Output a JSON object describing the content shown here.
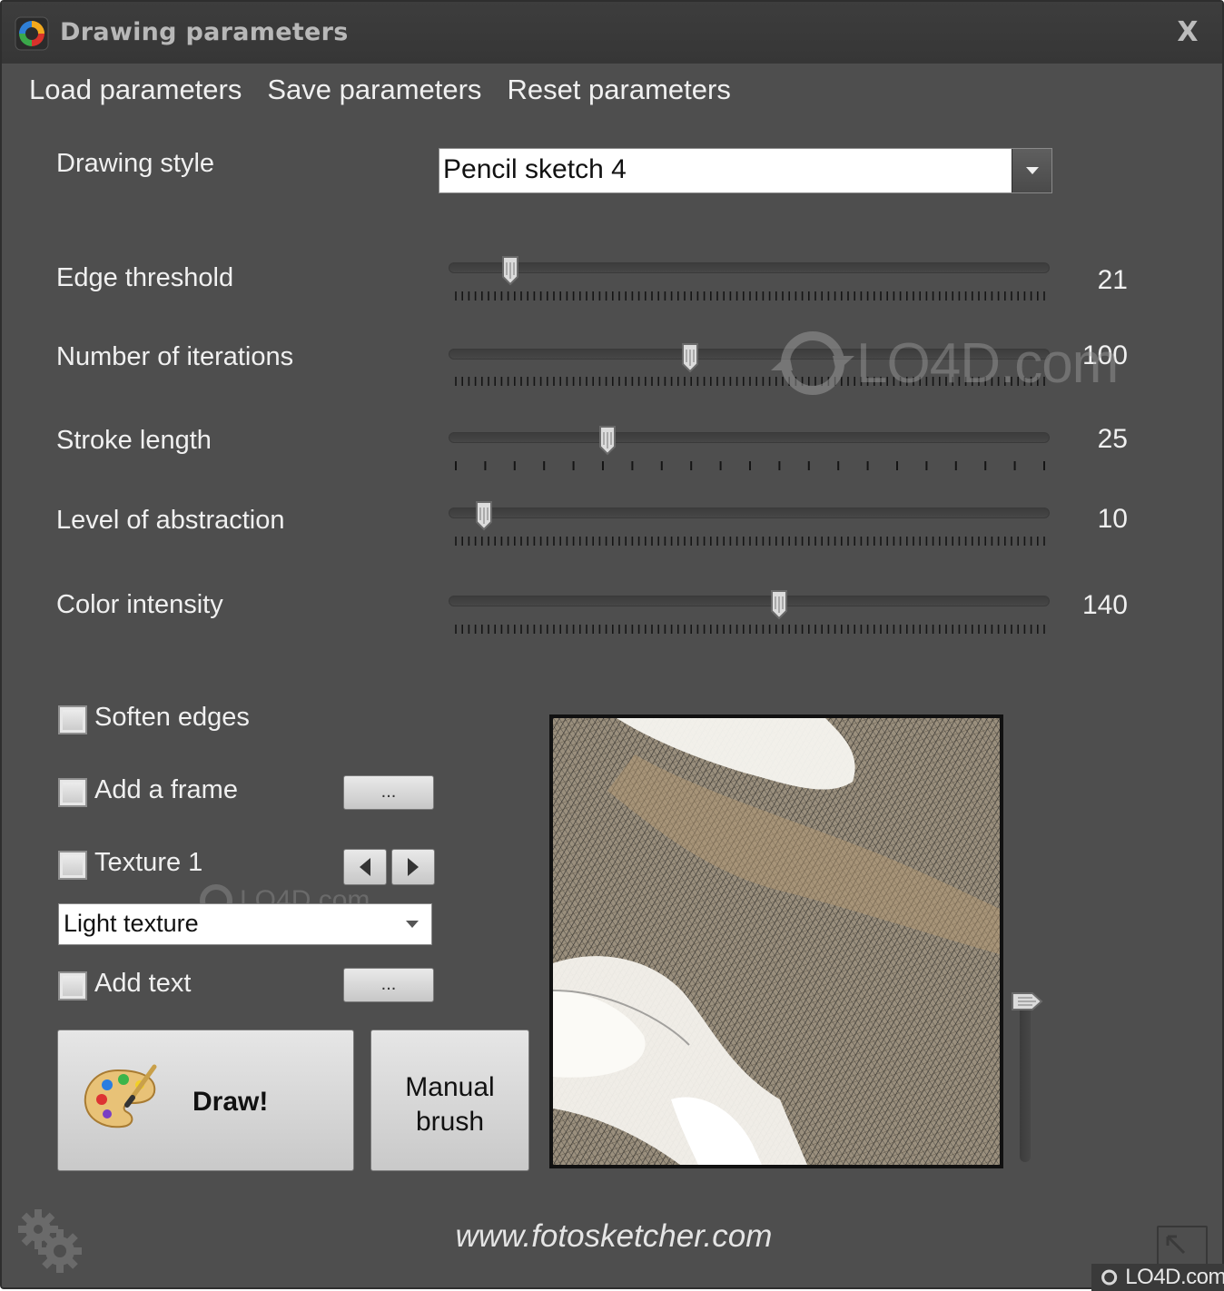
{
  "window": {
    "title": "Drawing parameters",
    "close_label": "X"
  },
  "menu": [
    "Load parameters",
    "Save parameters",
    "Reset parameters"
  ],
  "drawing_style": {
    "label": "Drawing style",
    "value": "Pencil sketch 4"
  },
  "sliders": [
    {
      "label": "Edge threshold",
      "value": "21",
      "position": 0.095,
      "ticks": "dense"
    },
    {
      "label": "Number of iterations",
      "value": "100",
      "position": 0.4,
      "ticks": "dense"
    },
    {
      "label": "Stroke length",
      "value": "25",
      "position": 0.26,
      "ticks": "sparse"
    },
    {
      "label": "Level of abstraction",
      "value": "10",
      "position": 0.05,
      "ticks": "dense"
    },
    {
      "label": "Color intensity",
      "value": "140",
      "position": 0.55,
      "ticks": "dense"
    }
  ],
  "options": {
    "soften_edges": {
      "label": "Soften edges",
      "checked": false
    },
    "add_frame": {
      "label": "Add a frame",
      "checked": false,
      "button": "..."
    },
    "texture": {
      "label": "Texture 1",
      "checked": false,
      "select_value": "Light texture"
    },
    "add_text": {
      "label": "Add text",
      "checked": false,
      "button": "..."
    }
  },
  "buttons": {
    "draw": "Draw!",
    "manual_line1": "Manual",
    "manual_line2": "brush"
  },
  "preview": {
    "zoom_position": 0.0
  },
  "footer": {
    "url": "www.fotosketcher.com"
  },
  "watermarks": {
    "main": "LO4D.com",
    "small": "LO4D.com",
    "corner": "LO4D.com"
  },
  "icons": [
    "app-logo-icon",
    "close-icon",
    "dropdown-arrow-icon",
    "arrow-left-icon",
    "arrow-right-icon",
    "palette-icon",
    "gear-icon",
    "resize-icon"
  ]
}
